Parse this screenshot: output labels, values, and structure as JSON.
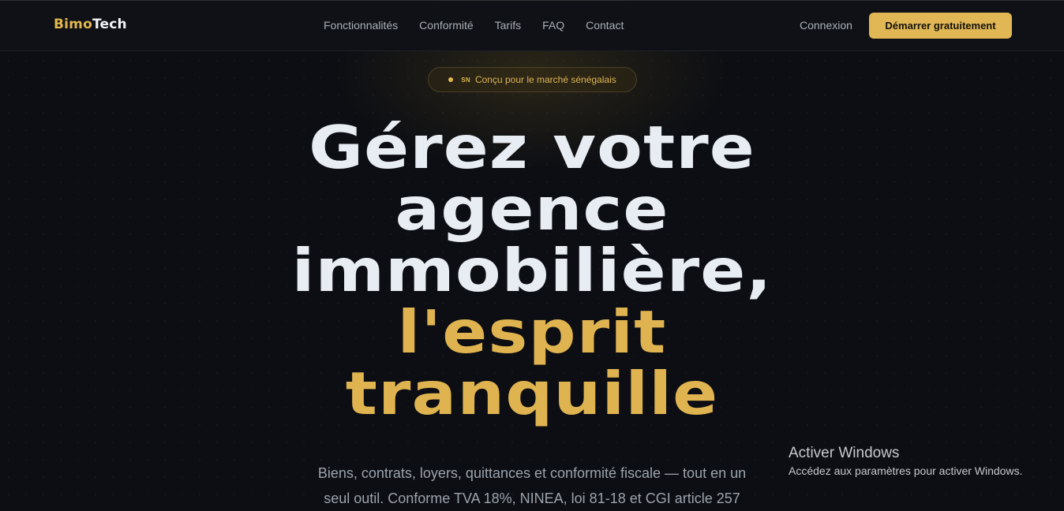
{
  "brand": {
    "part1": "Bimo",
    "part2": "Tech"
  },
  "nav": {
    "items": [
      "Fonctionnalités",
      "Conformité",
      "Tarifs",
      "FAQ",
      "Contact"
    ]
  },
  "auth": {
    "login": "Connexion",
    "cta": "Démarrer gratuitement"
  },
  "badge": {
    "flag": "SN",
    "text": "Conçu pour le marché sénégalais"
  },
  "hero": {
    "line1": "Gérez votre",
    "line2": "agence",
    "line3": "immobilière,",
    "line4": "l'esprit",
    "line5": "tranquille",
    "lead": "Biens, contrats, loyers, quittances et conformité fiscale — tout en un seul outil. Conforme TVA 18%, NINEA, loi 81-18 et CGI article 257"
  },
  "windows": {
    "title": "Activer Windows",
    "subtitle": "Accédez aux paramètres pour activer Windows."
  },
  "colors": {
    "accent": "#e0b754",
    "background": "#0c0e13"
  }
}
